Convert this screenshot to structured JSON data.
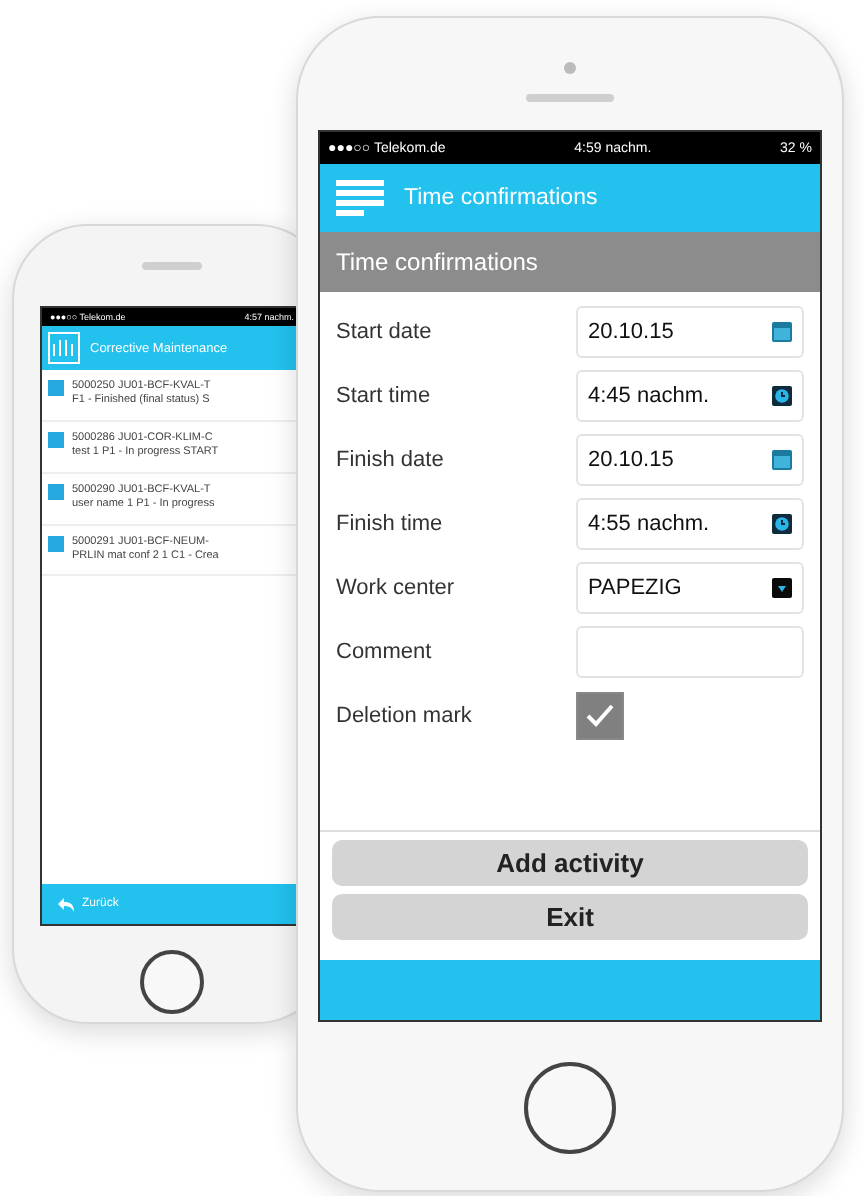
{
  "back_phone": {
    "status_bar": {
      "carrier": "●●●○○ Telekom.de",
      "time": "4:57 nachm."
    },
    "header": {
      "title": "Corrective Maintenance"
    },
    "items": [
      {
        "line_1": "5000250 JU01-BCF-KVAL-T",
        "line_2": "F1 - Finished (final status)  S"
      },
      {
        "line_1": "5000286 JU01-COR-KLIM-C",
        "line_2": "test 1 P1 - In progress  START"
      },
      {
        "line_1": "5000290 JU01-BCF-KVAL-T",
        "line_2": "user name 1 P1 - In progress"
      },
      {
        "line_1": "5000291 JU01-BCF-NEUM-",
        "line_2": "PRLIN mat conf 2 1 C1 - Crea"
      }
    ],
    "back_button": "Zurück"
  },
  "front_phone": {
    "status_bar": {
      "carrier": "●●●○○ Telekom.de",
      "time": "4:59 nachm.",
      "battery": "32 %"
    },
    "header": {
      "title": "Time confirmations"
    },
    "section_title": "Time confirmations",
    "fields": [
      {
        "label": "Start date",
        "kind": "date",
        "value": "20.10.15"
      },
      {
        "label": "Start time",
        "kind": "time",
        "value": "4:45 nachm."
      },
      {
        "label": "Finish date",
        "kind": "date",
        "value": "20.10.15"
      },
      {
        "label": "Finish time",
        "kind": "time",
        "value": "4:55 nachm."
      },
      {
        "label": "Work center",
        "kind": "select",
        "value": "PAPEZIG"
      },
      {
        "label": "Comment",
        "kind": "text"
      },
      {
        "label": "Deletion mark",
        "kind": "checkbox",
        "checked": true
      }
    ],
    "buttons": [
      "Add activity",
      "Exit"
    ]
  }
}
